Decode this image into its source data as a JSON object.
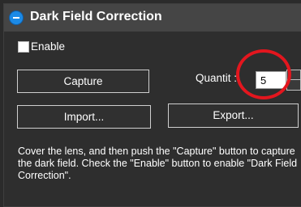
{
  "panel": {
    "title": "Dark Field Correction",
    "enable_label": "Enable",
    "enable_checked": false
  },
  "buttons": {
    "capture": "Capture",
    "import": "Import...",
    "export": "Export..."
  },
  "quantity": {
    "label": "Quantit :",
    "value": "5"
  },
  "description": "Cover the lens, and then push the \"Capture\" button to capture the dark field. Check the \"Enable\" button to enable \"Dark Field Correction\".",
  "colors": {
    "background": "#2e2e2e",
    "header": "#454545",
    "accent_blue": "#1c8ae6",
    "highlight_red": "#e3161e"
  },
  "icons": {
    "collapse": "minus-circle-icon"
  }
}
